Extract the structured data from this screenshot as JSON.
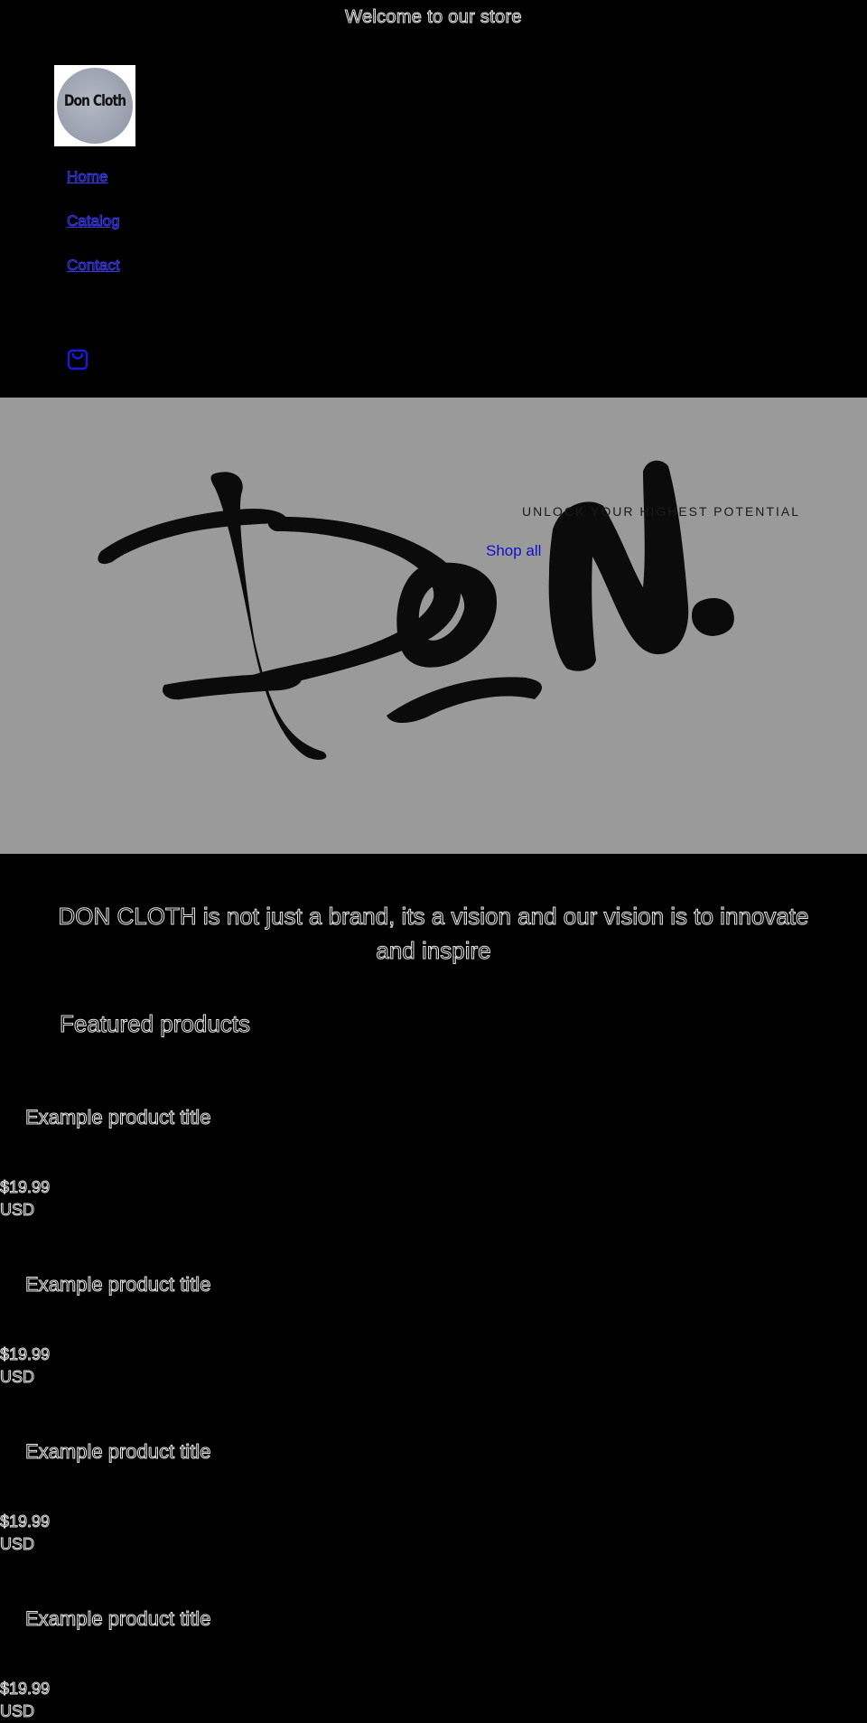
{
  "announcement": "Welcome to our store",
  "logo": {
    "text": "Don Cloth"
  },
  "nav": {
    "items": [
      "Home",
      "Catalog",
      "Contact"
    ]
  },
  "hero": {
    "subheading": "UNLOCK YOUR HIGHEST POTENTIAL",
    "button_label": "Shop all",
    "artwork_text": "DoN."
  },
  "tagline": "DON CLOTH is not just a brand, its a vision and our vision is to innovate and inspire",
  "featured": {
    "heading": "Featured products",
    "products": [
      {
        "title": "Example product title",
        "price": "$19.99",
        "currency": "USD"
      },
      {
        "title": "Example product title",
        "price": "$19.99",
        "currency": "USD"
      },
      {
        "title": "Example product title",
        "price": "$19.99",
        "currency": "USD"
      },
      {
        "title": "Example product title",
        "price": "$19.99",
        "currency": "USD"
      }
    ]
  },
  "colors": {
    "background": "#000000",
    "hero_background": "#9a9a9a",
    "link": "#3a3ae8",
    "text_outline": "#e6e6e6"
  },
  "icons": {
    "cart": "shopping-bag-icon"
  }
}
